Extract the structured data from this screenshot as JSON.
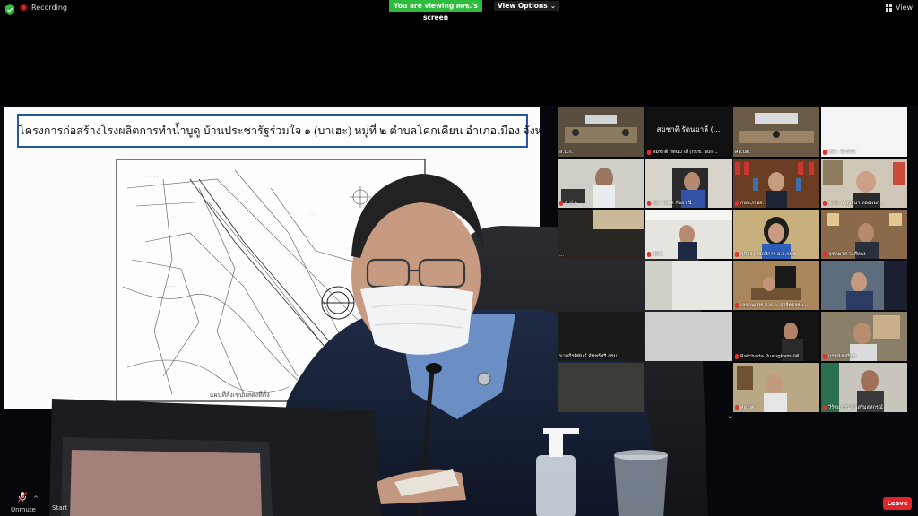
{
  "topbar": {
    "recording_label": "Recording",
    "viewing_banner": "You are viewing สศช.'s screen",
    "view_options_label": "View Options",
    "view_button_label": "View"
  },
  "slide": {
    "title": "โครงการก่อสร้างโรงผลิตการทำน้ำบูดู บ้านประชารัฐร่วมใจ ๑ (บาเฮะ) หมู่ที่ ๒ ตำบลโคกเคียน อำเภอเมือง จังหวัดนราธิวาส",
    "map_caption": "แผนที่สังเขปแสดงที่ตั้ง"
  },
  "gallery": {
    "tiles": [
      {
        "name": "ส.ป.ก.",
        "big_label": ""
      },
      {
        "name": "สมชาติ รัตนมาลี (กปช. สบก...",
        "big_label": "สมชาติ รัตนมาลี (..."
      },
      {
        "name": "ศอ.บต.",
        "big_label": ""
      },
      {
        "name": "สศก. สิกรักษ์",
        "big_label": ""
      },
      {
        "name": "ส.ป.ก. ...",
        "big_label": ""
      },
      {
        "name": "ทก. โกศล กัลยาณี",
        "big_label": ""
      },
      {
        "name": "กษพ./กมส.",
        "big_label": ""
      },
      {
        "name": "นวช. กาญจนา ทองพพก...",
        "big_label": ""
      },
      {
        "name": "...",
        "big_label": ""
      },
      {
        "name": "สศช",
        "big_label": ""
      },
      {
        "name": "ศุภิสรา เอกสิการ ผ.อ.กปช.",
        "big_label": ""
      },
      {
        "name": "จุฑามาส วงศ์ทอง",
        "big_label": ""
      },
      {
        "name": "",
        "big_label": ""
      },
      {
        "name": "เลขานุการ ส.ป.ก. สุจริตธรรม...",
        "big_label": ""
      },
      {
        "name": "",
        "big_label": ""
      },
      {
        "name": "นายกีรติพันธ์ จันทร์ศรี กรม...",
        "big_label": ""
      },
      {
        "name": "",
        "big_label": ""
      },
      {
        "name": "Ratchada Puangkam กศ...",
        "big_label": ""
      },
      {
        "name": "กรมส่งเสริมฯ",
        "big_label": ""
      },
      {
        "name": "",
        "big_label": ""
      },
      {
        "name": "ศอ.บต.",
        "big_label": ""
      },
      {
        "name": "วีร์ชย กรมส่งเสริมสหกรณ์",
        "big_label": ""
      }
    ]
  },
  "controls": {
    "unmute_label": "Unmute",
    "start_label": "Start",
    "leave_label": "Leave"
  },
  "colors": {
    "viewing_banner": "#2dbc3c",
    "leave_button": "#e0262b",
    "active_speaker_border": "#e5d33a",
    "slide_title_border": "#2457a6"
  }
}
